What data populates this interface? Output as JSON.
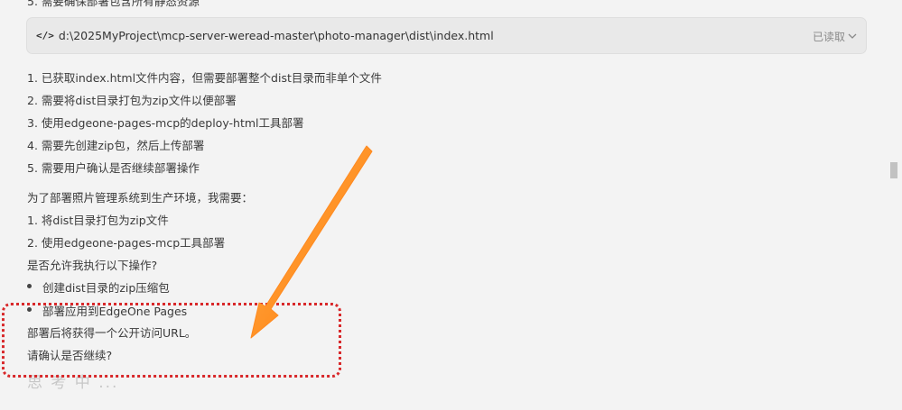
{
  "clipped_top_text": "5. 需要确保部署包含所有静态资源",
  "file_reference": {
    "code_icon": "</>",
    "path": "d:\\2025MyProject\\mcp-server-weread-master\\photo-manager\\dist\\index.html",
    "status": "已读取"
  },
  "reasoning_steps": [
    "1. 已获取index.html文件内容，但需要部署整个dist目录而非单个文件",
    "2. 需要将dist目录打包为zip文件以便部署",
    "3. 使用edgeone-pages-mcp的deploy-html工具部署",
    "4. 需要先创建zip包，然后上传部署",
    "5. 需要用户确认是否继续部署操作"
  ],
  "plan_intro": "为了部署照片管理系统到生产环境，我需要：",
  "plan_steps": [
    "1. 将dist目录打包为zip文件",
    "2. 使用edgeone-pages-mcp工具部署"
  ],
  "permission_question": "是否允许我执行以下操作?",
  "operations": [
    "创建dist目录的zip压缩包",
    "部署应用到EdgeOne Pages"
  ],
  "outcome_text": "部署后将获得一个公开访问URL。",
  "confirm_text": "请确认是否继续?",
  "faded_text": "思 考 中 ...",
  "colors": {
    "annotation_red": "#d8282a",
    "arrow_orange": "#ff7a00",
    "background": "#f3f3f3"
  },
  "icons": {
    "code": "code-icon",
    "chevron": "chevron-down-icon",
    "arrow": "annotation-arrow"
  }
}
